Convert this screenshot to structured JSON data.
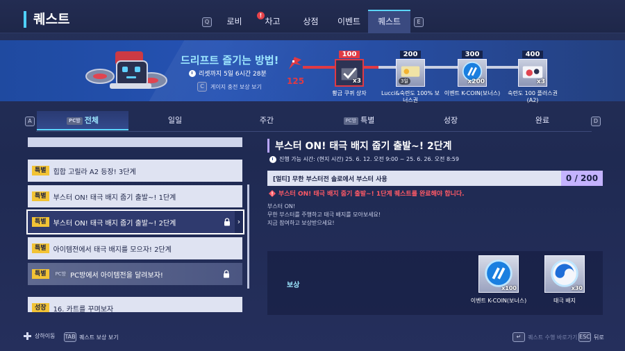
{
  "header": {
    "title": "퀘스트",
    "key_left": "Q",
    "key_right": "E",
    "tabs": [
      {
        "label": "로비"
      },
      {
        "label": "차고",
        "alert": "!"
      },
      {
        "label": "상점"
      },
      {
        "label": "이벤트"
      },
      {
        "label": "퀘스트",
        "active": true
      }
    ]
  },
  "banner": {
    "title": "드리프트 즐기는 방법!",
    "timer": "리셋까지 5일 6시간 28분",
    "gauge_key": "C",
    "gauge_hint": "게이지 충전 보상 보기",
    "gauge_value": "125",
    "gauge_max": 400,
    "milestones": [
      {
        "value": "100",
        "label": "황금 쿠퀴 상자",
        "count": "x3",
        "done": true
      },
      {
        "value": "200",
        "label": "Lucci&숙련도 100% 보너스권",
        "sub": "3일"
      },
      {
        "value": "300",
        "label": "이벤트 K-COIN(보너스)",
        "count": "x200"
      },
      {
        "value": "400",
        "label": "숙련도 100 플러스권 (A2)",
        "count": "x3"
      }
    ]
  },
  "filters": {
    "key_left": "A",
    "key_right": "D",
    "pc_chip": "PC방",
    "tabs": [
      {
        "label": "전체",
        "pc": true,
        "active": true
      },
      {
        "label": "일일"
      },
      {
        "label": "주간"
      },
      {
        "label": "특별",
        "pc": true
      },
      {
        "label": "성장"
      },
      {
        "label": "완료"
      }
    ]
  },
  "quests": [
    {
      "tag": "특별",
      "title": "힙합 고릴라 A2 등장! 3단계"
    },
    {
      "tag": "특별",
      "title": "부스터 ON! 태극 배지 줍기 출발~! 1단계"
    },
    {
      "tag": "특별",
      "title": "부스터 ON! 태극 배지 줍기 출발~! 2단계",
      "selected": true,
      "locked": true
    },
    {
      "tag": "특별",
      "title": "아이템전에서 태극 배지를 모으자! 2단계"
    },
    {
      "tag": "특별",
      "title": "PC방에서 아이템전을 달려보자!",
      "pc": true,
      "locked": true
    },
    {
      "tag": "성장",
      "title": "16. 카트를 꾸며보자"
    }
  ],
  "detail": {
    "title": "부스터 ON! 태극 배지 줍기 출발~! 2단계",
    "period": "진행 가능 시간: (현지 시간) 25. 6. 12. 오전 9:00 ~ 25. 6. 26. 오전 8:59",
    "mission": "[멀티] 무한 부스터전 솔로에서 부스터 사용",
    "progress": "0 / 200",
    "warning": "부스터 ON! 태극 배지 줍기 출발~! 1단계 퀘스트를 완료해야 합니다.",
    "desc_lines": [
      "부스터 ON!",
      "무한 부스터를 주행하고 태극 배지를 모아보세요!",
      "지금 참여하고 보상받으세요!"
    ],
    "reward_label": "보상",
    "rewards": [
      {
        "name": "이벤트 K-COIN(보너스)",
        "qty": "x100"
      },
      {
        "name": "태극 배지",
        "qty": "x30"
      }
    ]
  },
  "footer": {
    "move": "상하이동",
    "tab_key": "TAB",
    "tab_label": "퀘스트 보상 보기",
    "enter_label": "퀘스트 수행 바로가기",
    "esc_key": "ESC",
    "esc_label": "뒤로"
  },
  "colors": {
    "accent": "#5ad6ff",
    "alert": "#e03a44",
    "tag": "#f2c335",
    "progress": "#c4b3ff"
  }
}
